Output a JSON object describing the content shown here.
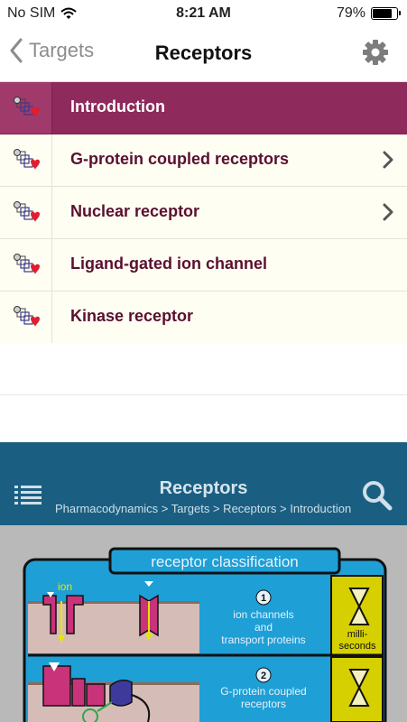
{
  "status": {
    "carrier": "No SIM",
    "time": "8:21 AM",
    "battery": "79%",
    "battery_level": 0.79
  },
  "nav": {
    "back_label": "Targets",
    "title": "Receptors",
    "back_icon": "chevron-left-icon",
    "settings_icon": "gear-icon"
  },
  "list": {
    "items": [
      {
        "label": "Introduction",
        "active": true,
        "chevron": false
      },
      {
        "label": "G-protein coupled receptors",
        "active": false,
        "chevron": true
      },
      {
        "label": "Nuclear receptor",
        "active": false,
        "chevron": true
      },
      {
        "label": "Ligand-gated ion channel",
        "active": false,
        "chevron": false
      },
      {
        "label": "Kinase receptor",
        "active": false,
        "chevron": false
      }
    ]
  },
  "panel": {
    "title": "Receptors",
    "breadcrumb": "Pharmacodynamics > Targets > Receptors > Introduction",
    "menu_icon": "list-icon",
    "search_icon": "search-icon"
  },
  "figure": {
    "title": "receptor classification",
    "ion_label": "ion",
    "rows": [
      {
        "number": "1",
        "text": [
          "ion channels",
          "and",
          "transport proteins"
        ],
        "time": [
          "milli-",
          "seconds"
        ]
      },
      {
        "number": "2",
        "text": [
          "G-protein coupled",
          "receptors"
        ]
      }
    ]
  },
  "colors": {
    "accent": "#8e2a5c",
    "label": "#5a1030",
    "panel": "#1a5f82",
    "figure_blue": "#1e9fd6",
    "figure_yellow": "#d6d000",
    "figure_magenta": "#c8337a"
  }
}
